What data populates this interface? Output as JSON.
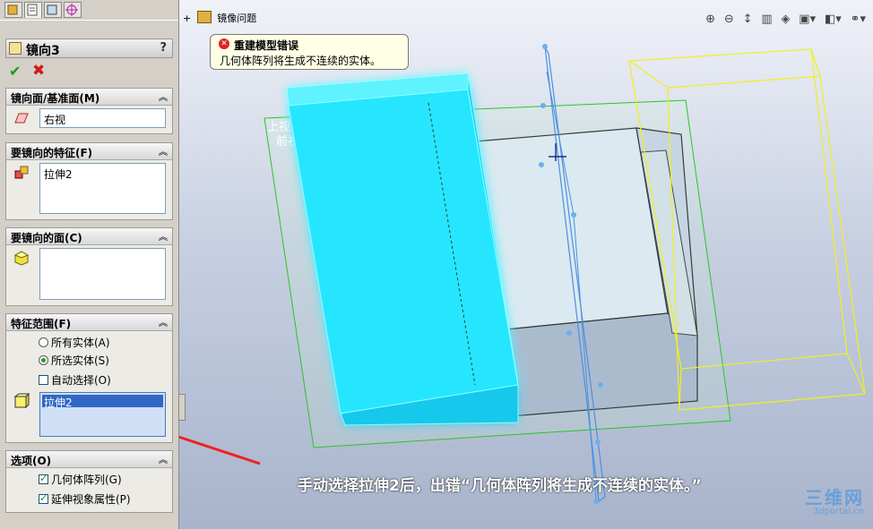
{
  "property_manager": {
    "title": "镜向3",
    "help": "?",
    "ok": "✔",
    "cancel": "✖",
    "groups": {
      "mirror_face": {
        "header": "镜向面/基准面(M)",
        "value": "右视"
      },
      "features": {
        "header": "要镜向的特征(F)",
        "items": [
          "拉伸2"
        ]
      },
      "faces": {
        "header": "要镜向的面(C)"
      },
      "scope": {
        "header": "特征范围(F)",
        "radio_all": "所有实体(A)",
        "radio_selected": "所选实体(S)",
        "auto_select": "自动选择(O)",
        "selected_body": "拉伸2"
      },
      "options": {
        "header": "选项(O)",
        "geometry_pattern": "几何体阵列(G)",
        "propagate_visual": "延伸视象属性(P)"
      }
    }
  },
  "viewport": {
    "breadcrumb": "镜像问题",
    "error_title": "重建模型错误",
    "error_message": "几何体阵列将生成不连续的实体。",
    "plane_labels": [
      "上视",
      "前视"
    ],
    "annotation": "手动选择拉伸2后，出错“几何体阵列将生成不连续的实体。”"
  },
  "watermark": {
    "main": "三维网",
    "sub": "3dportal.cn"
  }
}
